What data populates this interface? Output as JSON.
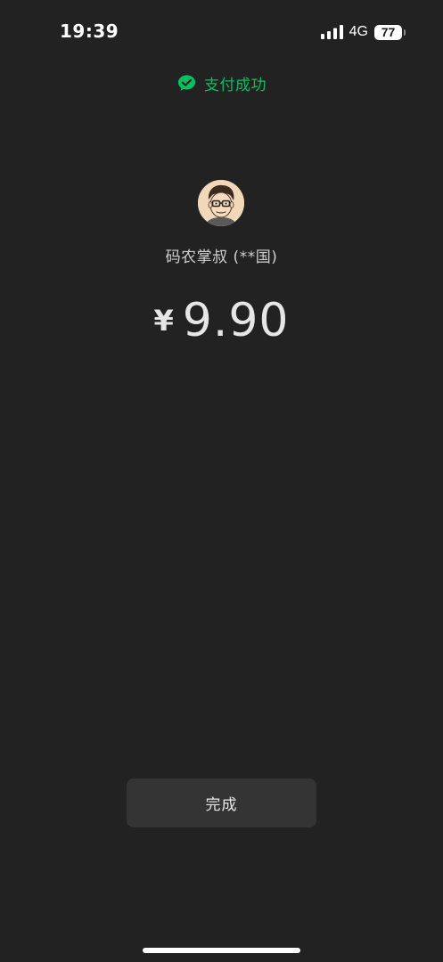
{
  "status_bar": {
    "time": "19:39",
    "network": "4G",
    "battery_level": "77",
    "icons": [
      "signal-icon",
      "battery-icon"
    ]
  },
  "header": {
    "icon": "wechat-pay-check-icon",
    "success_text": "支付成功",
    "accent_color": "#07c160"
  },
  "payee": {
    "avatar_icon": "avatar-cartoon-man-with-glasses",
    "name": "码农掌叔 (**国)"
  },
  "amount": {
    "currency_symbol": "¥",
    "value": "9.90"
  },
  "actions": {
    "done_label": "完成"
  },
  "colors": {
    "background": "#222222",
    "button_bg": "#343434",
    "success_green": "#07c160"
  }
}
